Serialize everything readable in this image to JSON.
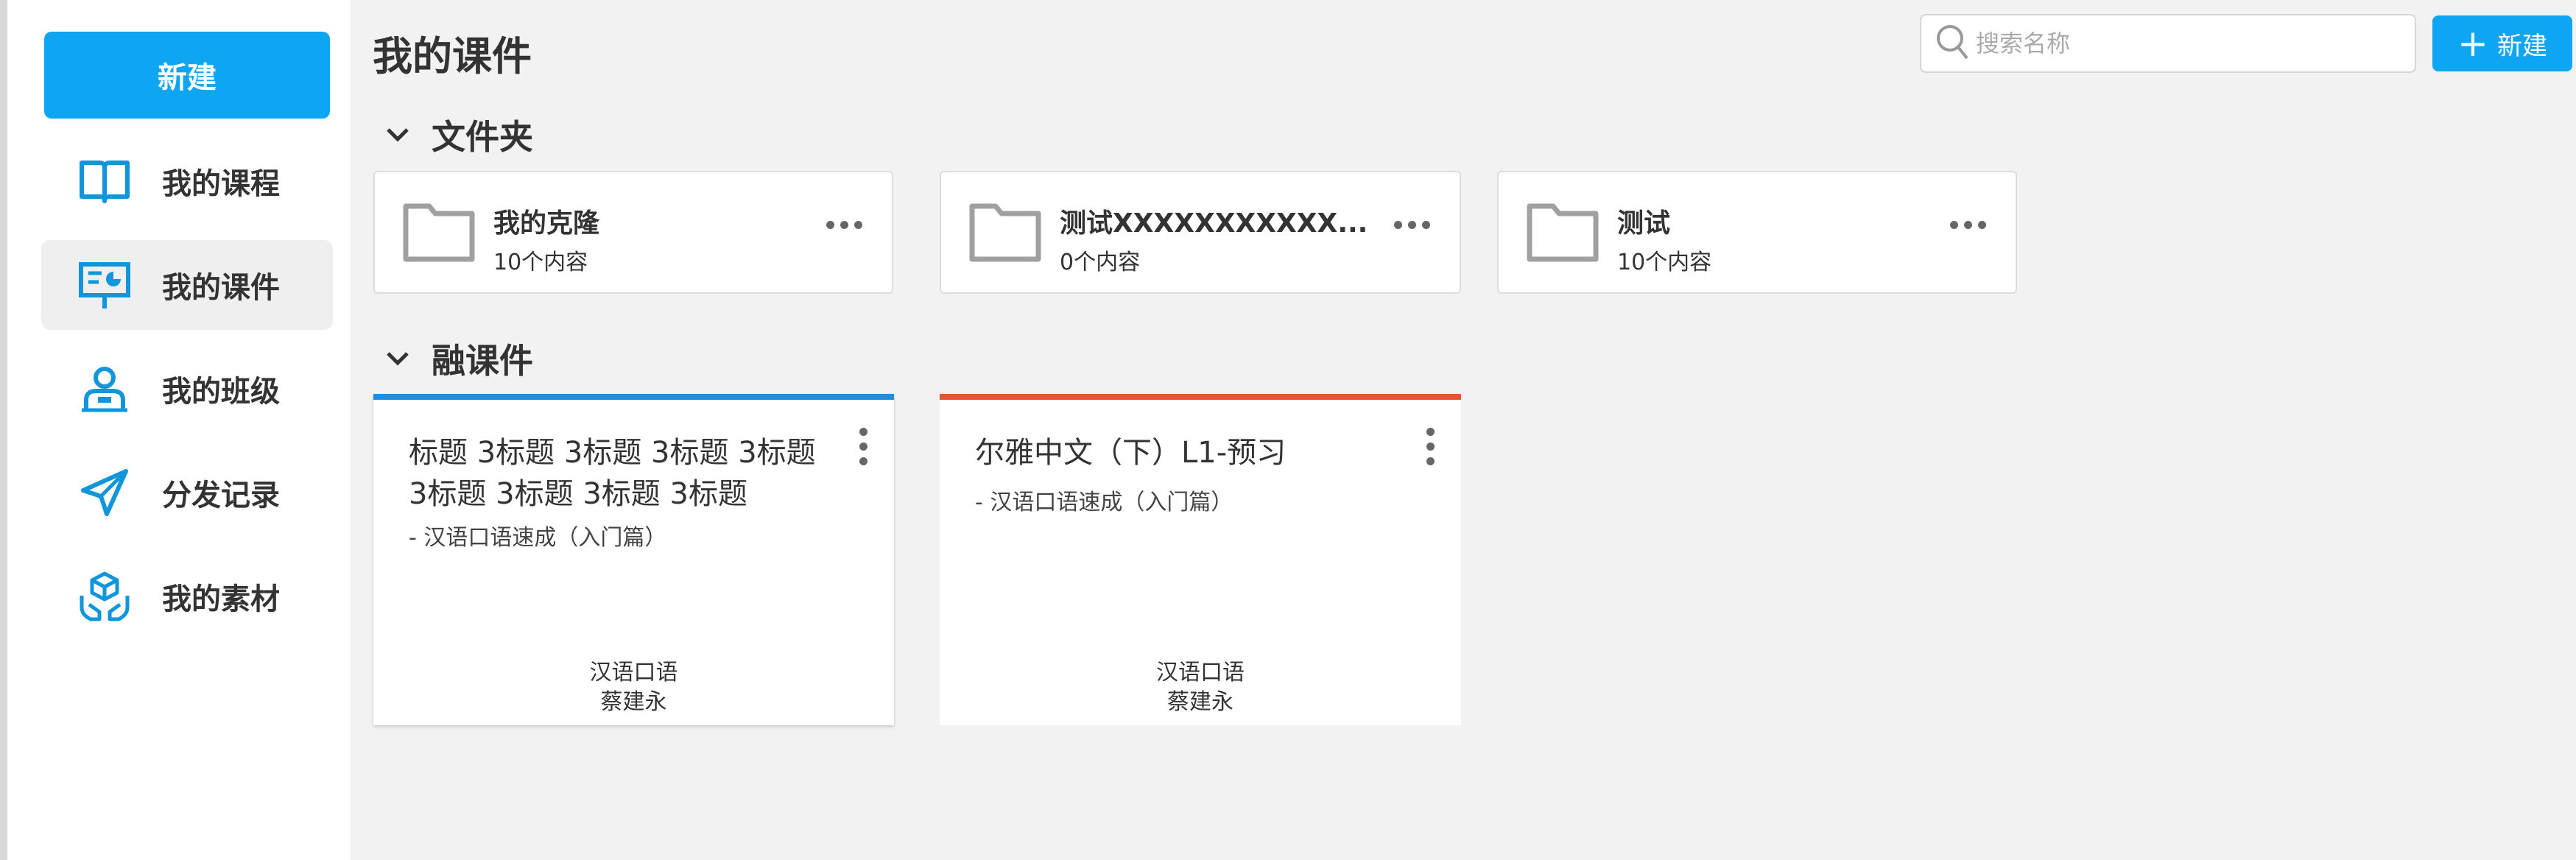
{
  "sidebar": {
    "new_button": "新建",
    "items": [
      {
        "label": "我的课程",
        "icon": "book-icon",
        "active": false
      },
      {
        "label": "我的课件",
        "icon": "presentation-icon",
        "active": true
      },
      {
        "label": "我的班级",
        "icon": "class-user-icon",
        "active": false
      },
      {
        "label": "分发记录",
        "icon": "paper-plane-icon",
        "active": false
      },
      {
        "label": "我的素材",
        "icon": "materials-hands-icon",
        "active": false
      }
    ]
  },
  "header": {
    "title": "我的课件",
    "search_placeholder": "搜索名称",
    "new_button": "新建"
  },
  "folders_section": {
    "title": "文件夹",
    "folders": [
      {
        "name": "我的克隆",
        "count": "10个内容"
      },
      {
        "name": "测试XXXXXXXXXXX...",
        "count": "0个内容"
      },
      {
        "name": "测试",
        "count": "10个内容"
      }
    ]
  },
  "courseware_section": {
    "title": "融课件",
    "cards": [
      {
        "title": "标题 3标题 3标题 3标题 3标题 3标题 3标题 3标题 3标题",
        "subtitle": "- 汉语口语速成（入门篇）",
        "category": "汉语口语",
        "author": "蔡建永",
        "accent": "#1a8fe3"
      },
      {
        "title": "尔雅中文（下）L1-预习",
        "subtitle": "- 汉语口语速成（入门篇）",
        "category": "汉语口语",
        "author": "蔡建永",
        "accent": "#e5562e"
      }
    ]
  },
  "colors": {
    "primary": "#0ea5f3",
    "icon_blue": "#1296db",
    "background": "#f2f2f2"
  }
}
